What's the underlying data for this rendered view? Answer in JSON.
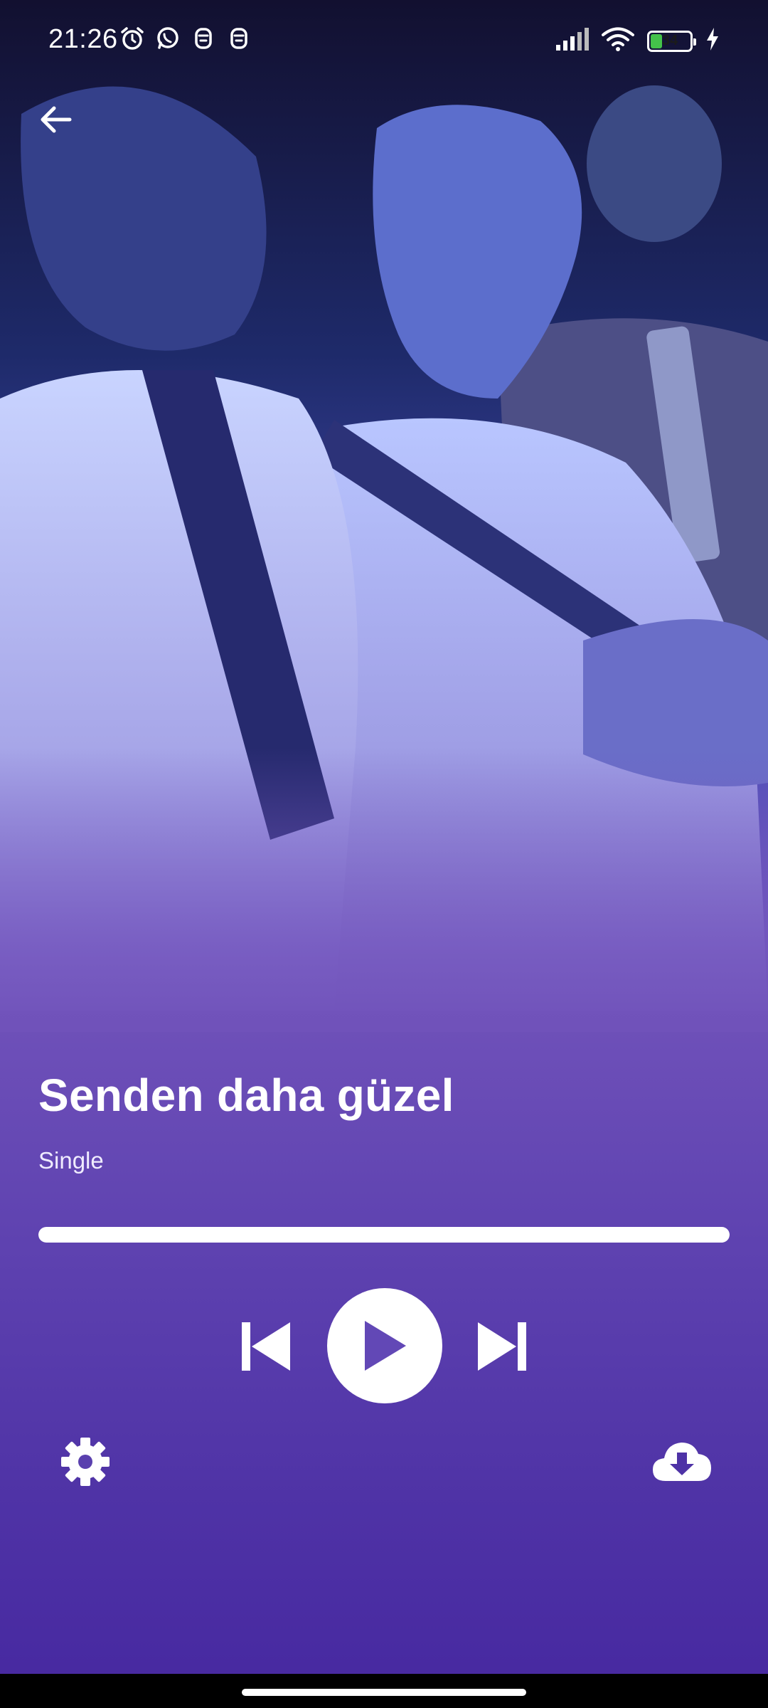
{
  "status_bar": {
    "time": "21:26",
    "left_icons": [
      "alarm-icon",
      "whatsapp-icon",
      "notification-icon",
      "notification-icon"
    ],
    "right_icons": [
      "signal-icon",
      "wifi-icon",
      "battery-icon",
      "charging-icon"
    ],
    "battery_level": "34",
    "battery_fraction": 0.34,
    "battery_color": "#44c24a"
  },
  "header": {
    "back_icon": "arrow-left-icon"
  },
  "track": {
    "title": "Senden daha güzel",
    "subtitle": "Single"
  },
  "progress": {
    "fraction": 1.0
  },
  "controls": {
    "previous_icon": "skip-previous-icon",
    "play_icon": "play-icon",
    "next_icon": "skip-next-icon"
  },
  "footer": {
    "settings_icon": "gear-icon",
    "download_icon": "cloud-download-icon"
  },
  "colors": {
    "accent_top": "#7052ba",
    "accent_bottom": "#4628a0",
    "foreground": "#ffffff"
  }
}
